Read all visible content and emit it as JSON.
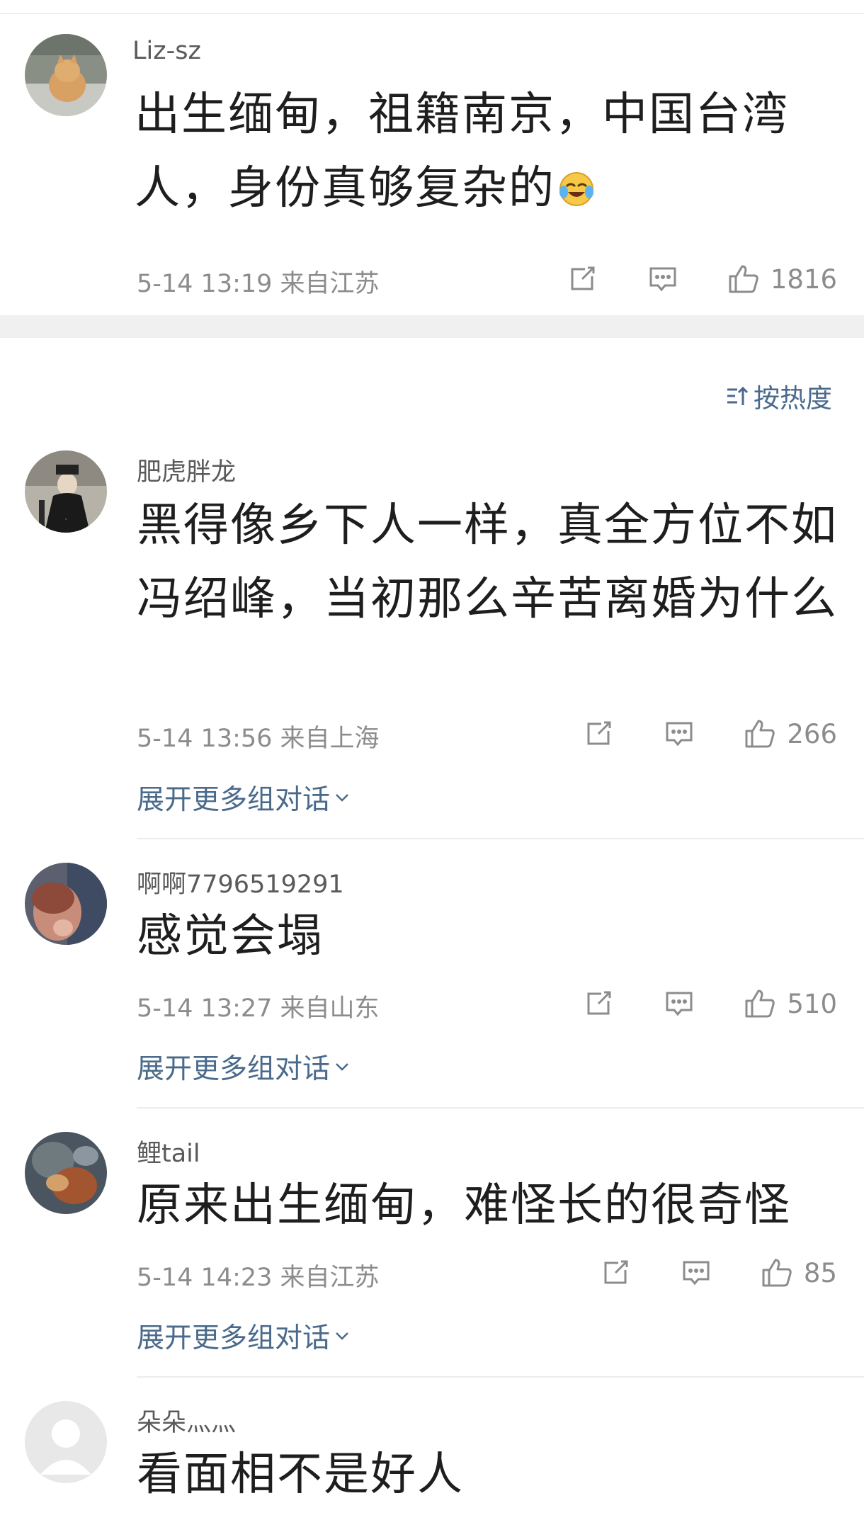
{
  "sort_label": "按热度",
  "comments": [
    {
      "username": "Liz-sz",
      "content": "出生缅甸，祖籍南京，中国台湾人，身份真够复杂的",
      "emoji": "laughing-crying-emoji",
      "meta": "5-14 13:19  来自江苏",
      "likes": "1816"
    },
    {
      "username": "肥虎胖龙",
      "content": "黑得像乡下人一样，真全方位不如冯绍峰，当初那么辛苦离婚为什么",
      "meta": "5-14 13:56  来自上海",
      "likes": "266",
      "expand": "展开更多组对话"
    },
    {
      "username": "啊啊7796519291",
      "content": "感觉会塌",
      "meta": "5-14 13:27  来自山东",
      "likes": "510",
      "expand": "展开更多组对话"
    },
    {
      "username": "鲤tail",
      "content": "原来出生缅甸，难怪长的很奇怪",
      "meta": "5-14 14:23  来自江苏",
      "likes": "85",
      "expand": "展开更多组对话"
    },
    {
      "username": "朵朵灬灬",
      "content": "看面相不是好人"
    }
  ],
  "colors": {
    "link": "#4a6a8c",
    "meta": "#8c8c8c",
    "text": "#1e1e1e",
    "divider": "#f0f0f0"
  }
}
